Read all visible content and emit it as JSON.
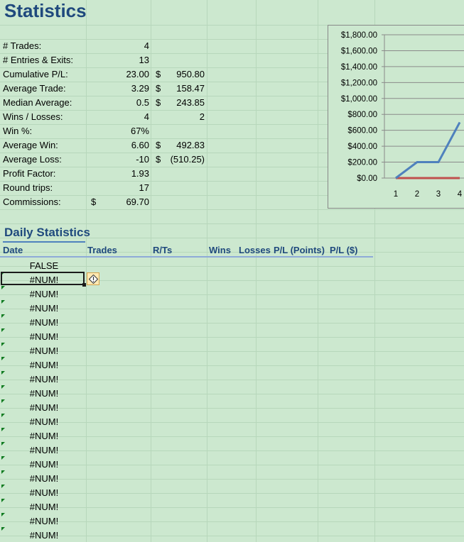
{
  "title": "Statistics",
  "stats": [
    {
      "label": "# Trades:",
      "value": "4"
    },
    {
      "label": "# Entries & Exits:",
      "value": "13"
    },
    {
      "label": "Cumulative P/L:",
      "value": "23.00",
      "currency": "$",
      "amount": "950.80"
    },
    {
      "label": "Average Trade:",
      "value": "3.29",
      "currency": "$",
      "amount": "158.47"
    },
    {
      "label": "Median Average:",
      "value": "0.5",
      "currency": "$",
      "amount": "243.85"
    },
    {
      "label": "Wins / Losses:",
      "value": "4",
      "amount2": "2"
    },
    {
      "label": "Win %:",
      "value": "67%"
    },
    {
      "label": "Average Win:",
      "value": "6.60",
      "currency": "$",
      "amount": "492.83"
    },
    {
      "label": "Average Loss:",
      "value": "-10",
      "currency": "$",
      "amount": "(510.25)"
    },
    {
      "label": "Profit Factor:",
      "value": "1.93"
    },
    {
      "label": "Round trips:",
      "value": "17"
    },
    {
      "label": "Commissions:",
      "currency_left": "$",
      "value": "69.70"
    }
  ],
  "daily": {
    "title": "Daily Statistics",
    "headers": [
      "Date",
      "Trades",
      "R/Ts",
      "Wins",
      "Losses",
      "P/L (Points)",
      "P/L ($)"
    ],
    "first_row": "FALSE",
    "error_value": "#NUM!",
    "error_count": 19
  },
  "chart_data": {
    "type": "line",
    "x": [
      1,
      2,
      3,
      4
    ],
    "y_tick_labels": [
      "$1,800.00",
      "$1,600.00",
      "$1,400.00",
      "$1,200.00",
      "$1,000.00",
      "$800.00",
      "$600.00",
      "$400.00",
      "$200.00",
      "$0.00"
    ],
    "ylim": [
      0,
      1800
    ],
    "series": [
      {
        "values": [
          0,
          200,
          200,
          700
        ],
        "color": "#4f81bd"
      },
      {
        "values": [
          0,
          0,
          0,
          0
        ],
        "color": "#c0504d"
      }
    ]
  }
}
